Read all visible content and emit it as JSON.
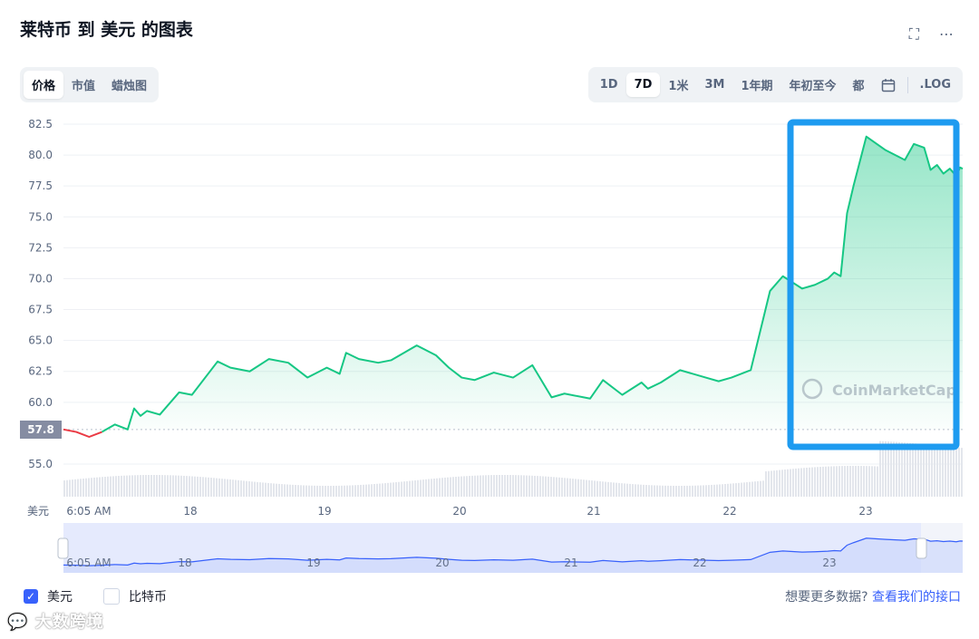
{
  "title": "莱特币 到 美元 的图表",
  "icons": {
    "fullscreen": "fullscreen-icon",
    "more": "more-dots-icon"
  },
  "left_tabs": [
    "价格",
    "市值",
    "蜡烛图"
  ],
  "left_active": 0,
  "right_tabs": [
    "1D",
    "7D",
    "1米",
    "3M",
    "1年期",
    "年初至今",
    "都"
  ],
  "right_active": 1,
  "calendar_icon": "calendar-icon",
  "log_label": ".LOG",
  "axis_unit": "美元",
  "current_price_label": "57.8",
  "watermark": "CoinMarketCap",
  "legend": [
    {
      "label": "美元",
      "checked": true
    },
    {
      "label": "比特币",
      "checked": false
    }
  ],
  "more_text": "想要更多数据?",
  "more_link": "查看我们的接口",
  "overlay_watermark": "大数跨境",
  "colors": {
    "up": "#16c784",
    "down": "#ea3943",
    "accent": "#3861fb",
    "highlight": "#1e9bf0",
    "navigator": "#3861fb"
  },
  "chart_data": {
    "type": "line",
    "y_ticks": [
      "82.5",
      "80.0",
      "77.5",
      "75.0",
      "72.5",
      "70.0",
      "67.5",
      "65.0",
      "62.5",
      "60.0",
      "55.0"
    ],
    "x_ticks": [
      "6:05 AM",
      "18",
      "19",
      "20",
      "21",
      "22",
      "23"
    ],
    "ylim": [
      52.5,
      82.5
    ],
    "reference_price": 57.8,
    "series": [
      {
        "x": [
          0,
          0.1,
          0.2,
          0.3,
          0.4,
          0.5,
          0.55,
          0.6,
          0.65,
          0.75,
          0.9,
          1.0,
          1.2,
          1.3,
          1.45,
          1.6,
          1.75,
          1.9,
          2.05,
          2.15,
          2.2,
          2.3,
          2.45,
          2.55,
          2.75,
          2.9,
          3.0,
          3.1,
          3.2,
          3.35,
          3.5,
          3.65,
          3.8,
          3.9,
          4.1,
          4.2,
          4.35,
          4.5,
          4.55,
          4.65,
          4.8,
          5.0,
          5.1,
          5.2,
          5.35,
          5.5,
          5.6,
          5.75,
          5.85,
          5.95,
          6.0,
          6.05,
          6.1,
          6.15,
          6.25,
          6.4,
          6.55,
          6.62,
          6.7,
          6.75,
          6.8,
          6.85,
          6.9,
          6.95,
          6.98,
          7.0
        ],
        "values": [
          57.8,
          57.6,
          57.2,
          57.6,
          58.2,
          57.8,
          59.5,
          58.9,
          59.3,
          59.0,
          60.8,
          60.6,
          63.3,
          62.8,
          62.5,
          63.5,
          63.2,
          62.0,
          62.8,
          62.3,
          64.0,
          63.5,
          63.2,
          63.4,
          64.6,
          63.8,
          62.8,
          62.0,
          61.8,
          62.4,
          62.0,
          63.0,
          60.4,
          60.7,
          60.3,
          61.8,
          60.6,
          61.6,
          61.1,
          61.6,
          62.6,
          62.0,
          61.7,
          62.0,
          62.6,
          69.0,
          70.2,
          69.2,
          69.5,
          70.0,
          70.5,
          70.2,
          75.3,
          77.5,
          81.5,
          80.4,
          79.6,
          80.9,
          80.6,
          78.8,
          79.2,
          78.5,
          78.9,
          78.3,
          79.0,
          78.9
        ]
      }
    ]
  }
}
